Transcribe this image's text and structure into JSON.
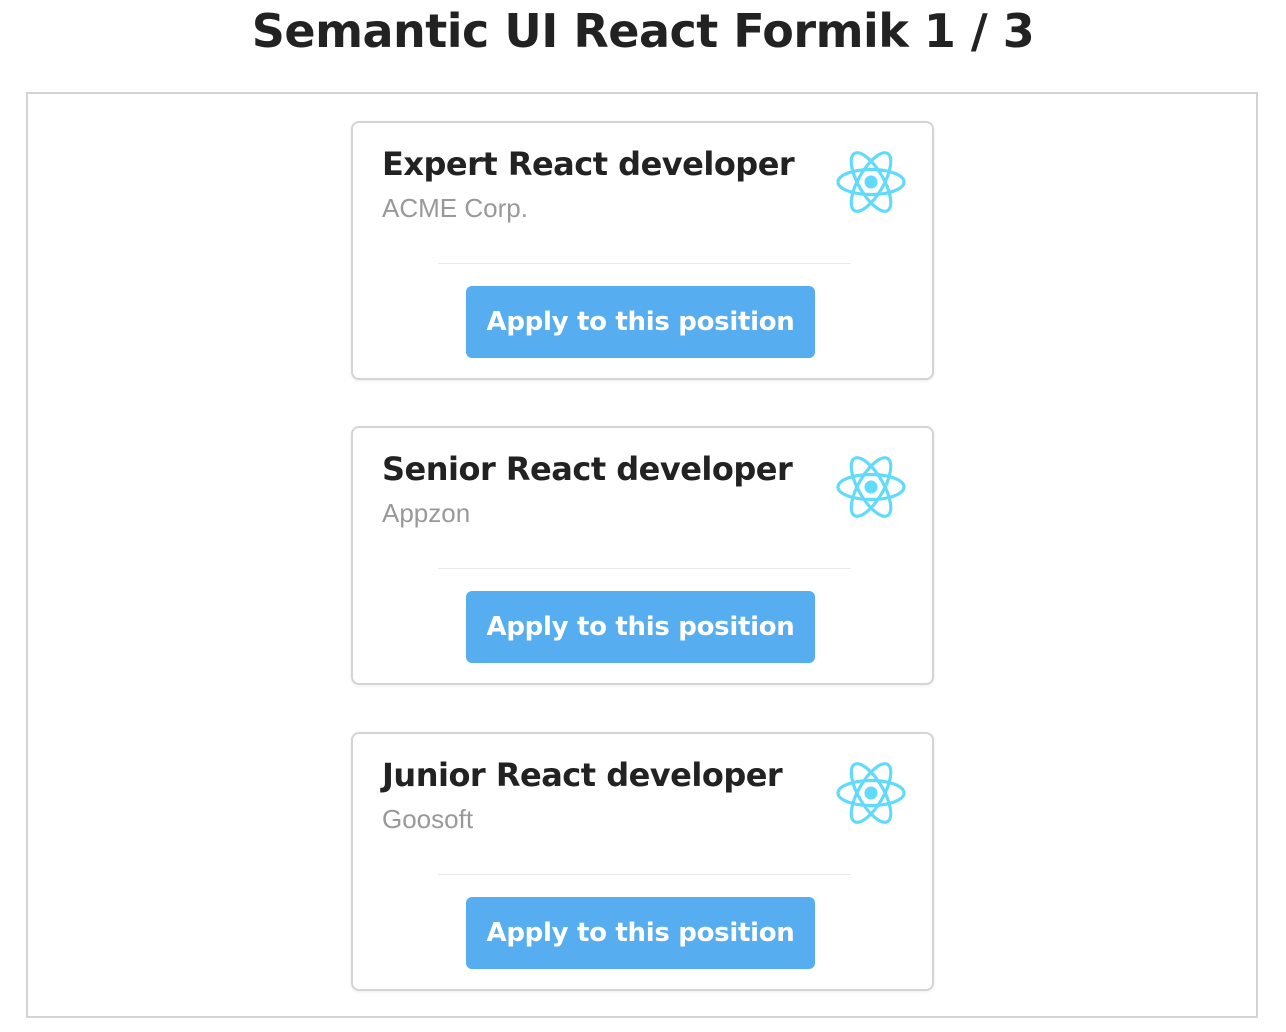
{
  "page": {
    "title": "Semantic UI React Formik 1 / 3"
  },
  "icons": {
    "logo": "react-logo-icon",
    "logo_color": "#61dafb"
  },
  "colors": {
    "button": "#56adef",
    "title_text": "#222222",
    "meta_text": "#999999"
  },
  "jobs": [
    {
      "title": "Expert React developer",
      "company": "ACME Corp.",
      "apply_label": "Apply to this position"
    },
    {
      "title": "Senior React developer",
      "company": "Appzon",
      "apply_label": "Apply to this position"
    },
    {
      "title": "Junior React developer",
      "company": "Goosoft",
      "apply_label": "Apply to this position"
    }
  ]
}
